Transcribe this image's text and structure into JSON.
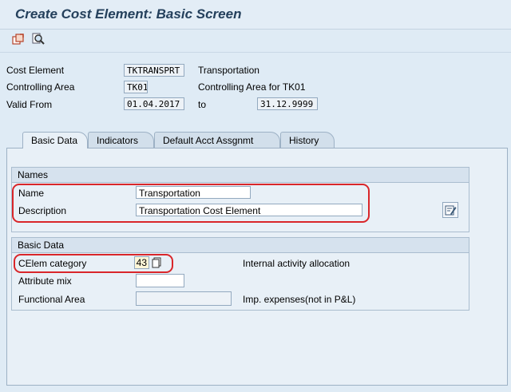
{
  "window": {
    "title": "Create Cost Element: Basic Screen"
  },
  "toolbar": {
    "icons": [
      "master-data-icon",
      "display-icon"
    ]
  },
  "header": {
    "cost_element_label": "Cost Element",
    "cost_element_value": "TKTRANSPRT",
    "cost_element_desc": "Transportation",
    "controlling_area_label": "Controlling Area",
    "controlling_area_value": "TK01",
    "controlling_area_desc": "Controlling Area for TK01",
    "valid_from_label": "Valid From",
    "valid_from_value": "01.04.2017",
    "to_label": "to",
    "valid_to_value": "31.12.9999"
  },
  "tabs": [
    "Basic Data",
    "Indicators",
    "Default Acct Assgnmt",
    "History"
  ],
  "names_group": {
    "title": "Names",
    "name_label": "Name",
    "name_value": "Transportation",
    "description_label": "Description",
    "description_value": "Transportation Cost Element"
  },
  "basic_group": {
    "title": "Basic Data",
    "category_label": "CElem category",
    "category_value": "43",
    "category_text": "Internal activity allocation",
    "attribute_mix_label": "Attribute mix",
    "attribute_mix_value": "",
    "functional_area_label": "Functional Area",
    "functional_area_value": "",
    "functional_area_text": "Imp. expenses(not in P&L)"
  },
  "colors": {
    "highlight": "#d9262a",
    "title": "#24405c",
    "background": "#dfebf5"
  }
}
